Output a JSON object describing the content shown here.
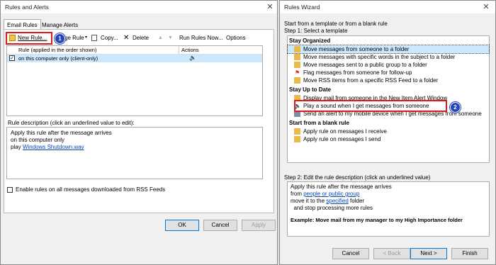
{
  "colors": {
    "accent": "#0078d7",
    "badge": "#2546b8",
    "highlight": "#e01818",
    "selection": "#cce8ff",
    "link": "#0645ad"
  },
  "left": {
    "title": "Rules and Alerts",
    "tabs": [
      "Email Rules",
      "Manage Alerts"
    ],
    "toolbar": {
      "new_rule": "New Rule...",
      "change_rule": "ge Rule",
      "copy": "Copy...",
      "delete": "Delete",
      "run_rules": "Run Rules Now...",
      "options": "Options"
    },
    "columns": {
      "rule": "Rule (applied in the order shown)",
      "actions": "Actions"
    },
    "rule_row": "on this computer only  (client-only)",
    "desc_label": "Rule description (click an underlined value to edit):",
    "desc_lines": [
      "Apply this rule after the message arrives",
      "on this computer only"
    ],
    "desc_play": "play",
    "desc_link": "Windows Shutdown.wav",
    "rss_checkbox": "Enable rules on all messages downloaded from RSS Feeds",
    "buttons": {
      "ok": "OK",
      "cancel": "Cancel",
      "apply": "Apply"
    },
    "badge": "1"
  },
  "right": {
    "title": "Rules Wizard",
    "intro": "Start from a template or from a blank rule",
    "step1": "Step 1: Select a template",
    "groups": {
      "organized": "Stay Organized",
      "uptodate": "Stay Up to Date",
      "blank": "Start from a blank rule"
    },
    "organized_items": [
      "Move messages from someone to a folder",
      "Move messages with specific words in the subject to a folder",
      "Move messages sent to a public group to a folder",
      "Flag messages from someone for follow-up",
      "Move RSS items from a specific RSS Feed to a folder"
    ],
    "uptodate_items": [
      "Display mail from someone in the New Item Alert Window",
      "Play a sound when I get messages from someone",
      "Send an alert to my mobile device when I get messages from someone"
    ],
    "blank_items": [
      "Apply rule on messages I receive",
      "Apply rule on messages I send"
    ],
    "step2": "Step 2: Edit the rule description (click an underlined value)",
    "step2_lines": {
      "l1": "Apply this rule after the message arrives",
      "l2_pre": "from ",
      "l2_link": "people or public group",
      "l3_pre": "move it to the ",
      "l3_link": "specified",
      "l3_post": " folder",
      "l4": "  and stop processing more rules"
    },
    "example": "Example: Move mail from my manager to my High Importance folder",
    "buttons": {
      "cancel": "Cancel",
      "back": "< Back",
      "next": "Next >",
      "finish": "Finish"
    },
    "badge": "2"
  }
}
